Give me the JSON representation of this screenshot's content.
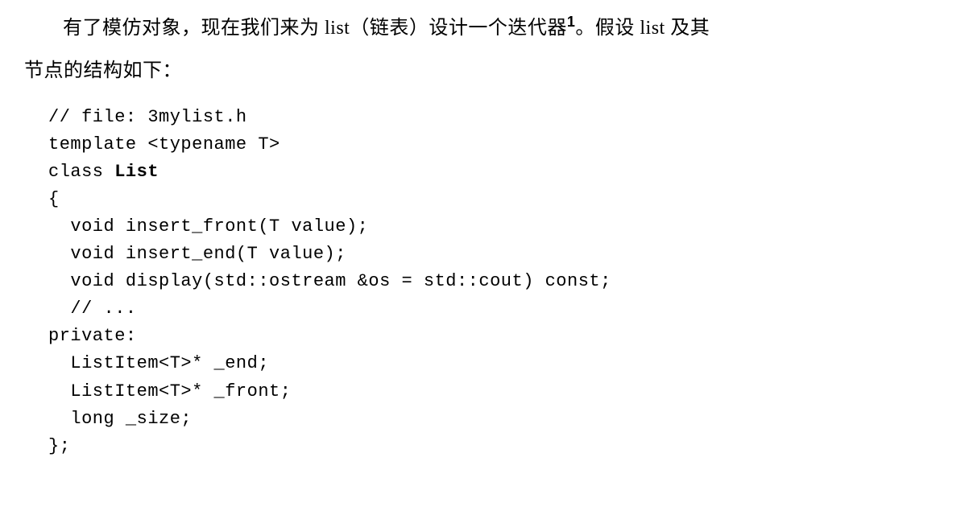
{
  "prose": {
    "p1_a": "有了模仿对象，现在我们来为 ",
    "p1_list1": "list",
    "p1_b": "（链表）设计一个迭代器",
    "p1_sup": "1",
    "p1_c": "。假设 ",
    "p1_list2": "list",
    "p1_d": " 及其",
    "p2": "节点的结构如下："
  },
  "code": {
    "l01": "// file: 3mylist.h",
    "l02": "template <typename T>",
    "l03a": "class ",
    "l03b": "List",
    "l04": "{",
    "l05": "  void insert_front(T value);",
    "l06": "  void insert_end(T value);",
    "l07": "  void display(std::ostream &os = std::cout) const;",
    "l08": "  // ...",
    "l09": "private:",
    "l10": "  ListItem<T>* _end;",
    "l11": "  ListItem<T>* _front;",
    "l12": "  long _size;",
    "l13": "};"
  }
}
